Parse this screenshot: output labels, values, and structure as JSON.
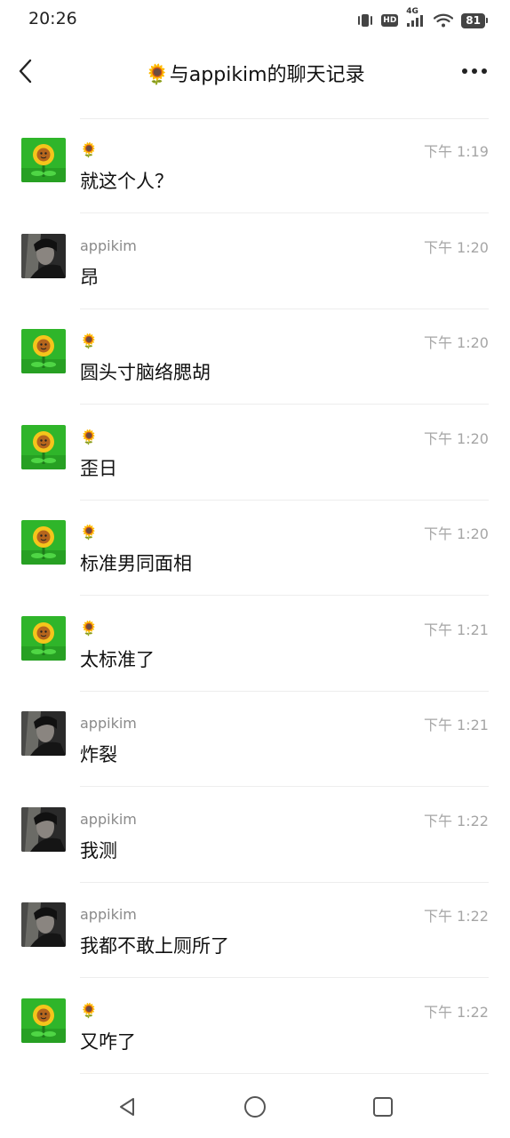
{
  "status_bar": {
    "time": "20:26",
    "hd_label": "HD",
    "network_label": "4G",
    "battery": "81"
  },
  "header": {
    "title": "与appikim的聊天记录",
    "title_emoji": "🌻"
  },
  "messages": [
    {
      "sender": "🌻",
      "avatar": "sunflower-avatar",
      "time": "下午 1:19",
      "text": "就这个人？"
    },
    {
      "sender": "appikim",
      "avatar": "person-avatar",
      "time": "下午 1:20",
      "text": "昂"
    },
    {
      "sender": "🌻",
      "avatar": "sunflower-avatar",
      "time": "下午 1:20",
      "text": "圆头寸脑络腮胡"
    },
    {
      "sender": "🌻",
      "avatar": "sunflower-avatar",
      "time": "下午 1:20",
      "text": "歪日"
    },
    {
      "sender": "🌻",
      "avatar": "sunflower-avatar",
      "time": "下午 1:20",
      "text": "标准男同面相"
    },
    {
      "sender": "🌻",
      "avatar": "sunflower-avatar",
      "time": "下午 1:21",
      "text": "太标准了"
    },
    {
      "sender": "appikim",
      "avatar": "person-avatar",
      "time": "下午 1:21",
      "text": "炸裂"
    },
    {
      "sender": "appikim",
      "avatar": "person-avatar",
      "time": "下午 1:22",
      "text": "我测"
    },
    {
      "sender": "appikim",
      "avatar": "person-avatar",
      "time": "下午 1:22",
      "text": "我都不敢上厕所了"
    },
    {
      "sender": "🌻",
      "avatar": "sunflower-avatar",
      "time": "下午 1:22",
      "text": "又咋了"
    }
  ],
  "icons": {
    "back": "chevron-left-icon",
    "more": "more-horizontal-icon",
    "nav_back": "triangle-back-icon",
    "nav_home": "circle-home-icon",
    "nav_recents": "square-recents-icon"
  },
  "colors": {
    "sunflower_bg": "#2fb52a",
    "divider": "#ededed",
    "time_text": "#a6a6a6",
    "sender_text": "#8a8a8a"
  }
}
